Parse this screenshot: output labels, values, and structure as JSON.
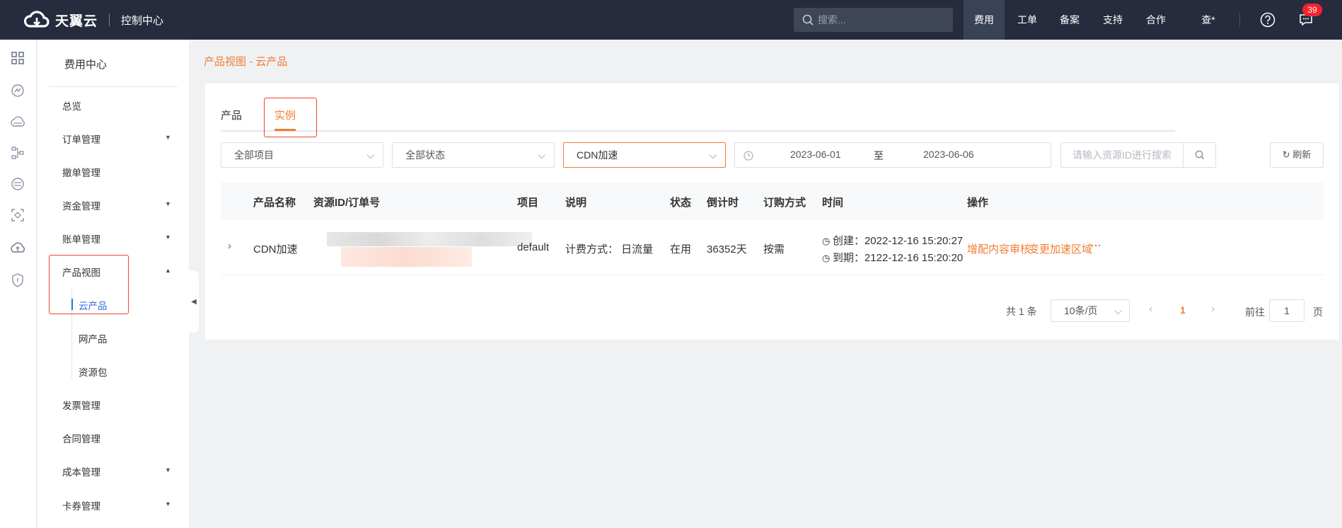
{
  "topbar": {
    "brand": "天翼云",
    "console": "控制中心",
    "search_placeholder": "搜索...",
    "nav": [
      "费用",
      "工单",
      "备案",
      "支持",
      "合作"
    ],
    "user": "查*",
    "badge": "39"
  },
  "menu": {
    "title": "费用中心",
    "items": [
      {
        "label": "总览",
        "caret": ""
      },
      {
        "label": "订单管理",
        "caret": "▼"
      },
      {
        "label": "撤单管理",
        "caret": ""
      },
      {
        "label": "资金管理",
        "caret": "▼"
      },
      {
        "label": "账单管理",
        "caret": "▼"
      },
      {
        "label": "产品视图",
        "caret": "▲"
      },
      {
        "label": "云产品",
        "caret": ""
      },
      {
        "label": "网产品",
        "caret": ""
      },
      {
        "label": "资源包",
        "caret": ""
      },
      {
        "label": "发票管理",
        "caret": ""
      },
      {
        "label": "合同管理",
        "caret": ""
      },
      {
        "label": "成本管理",
        "caret": "▼"
      },
      {
        "label": "卡券管理",
        "caret": "▼"
      }
    ]
  },
  "breadcrumb": "产品视图 - 云产品",
  "tabs": [
    "产品",
    "实例"
  ],
  "filters": {
    "project": "全部项目",
    "status": "全部状态",
    "product": "CDN加速",
    "date_from": "2023-06-01",
    "date_sep": "至",
    "date_to": "2023-06-06",
    "search_placeholder": "请输入资源ID进行搜索",
    "refresh": "刷新"
  },
  "table": {
    "headers": [
      "产品名称",
      "资源ID/订单号",
      "项目",
      "说明",
      "状态",
      "倒计时",
      "订购方式",
      "时间",
      "操作"
    ],
    "row": {
      "product": "CDN加速",
      "project": "default",
      "desc": "计费方式： 日流量",
      "status": "在用",
      "countdown": "36352天",
      "order_type": "按需",
      "created": "创建：2022-12-16 15:20:27",
      "expires": "到期：2122-12-16 15:20:20",
      "action1": "增配内容审核",
      "action2": "变更加速区域",
      "more": "···"
    }
  },
  "pagination": {
    "total": "共 1 条",
    "page_size": "10条/页",
    "current": "1",
    "goto_label": "前往",
    "goto_value": "1",
    "page_suffix": "页"
  }
}
